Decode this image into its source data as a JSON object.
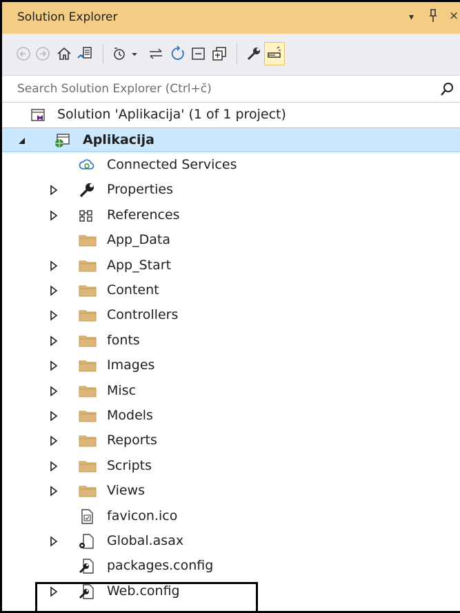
{
  "window": {
    "title": "Solution Explorer",
    "buttons": {
      "dropdown": "▾",
      "pin": "ꟸ",
      "close": "×"
    }
  },
  "toolbar": {
    "items": [
      "back-icon",
      "forward-icon",
      "home-icon",
      "switch-views-icon",
      "pending-changes-filter-icon",
      "sync-icon",
      "refresh-icon",
      "collapse-all-icon",
      "show-all-files-icon",
      "properties-icon",
      "preview-selected-items-icon"
    ]
  },
  "search": {
    "placeholder": "Search Solution Explorer (Ctrl+č)"
  },
  "tree": {
    "solution": {
      "label": "Solution 'Aplikacija' (1 of 1 project)"
    },
    "project": {
      "label": "Aplikacija"
    },
    "items": [
      {
        "label": "Connected Services",
        "icon": "connected-services-icon",
        "expandable": false
      },
      {
        "label": "Properties",
        "icon": "wrench-icon",
        "expandable": true
      },
      {
        "label": "References",
        "icon": "references-icon",
        "expandable": true
      },
      {
        "label": "App_Data",
        "icon": "folder-icon",
        "expandable": false
      },
      {
        "label": "App_Start",
        "icon": "folder-icon",
        "expandable": true
      },
      {
        "label": "Content",
        "icon": "folder-icon",
        "expandable": true
      },
      {
        "label": "Controllers",
        "icon": "folder-icon",
        "expandable": true
      },
      {
        "label": "fonts",
        "icon": "folder-icon",
        "expandable": true
      },
      {
        "label": "Images",
        "icon": "folder-icon",
        "expandable": true
      },
      {
        "label": "Misc",
        "icon": "folder-icon",
        "expandable": true
      },
      {
        "label": "Models",
        "icon": "folder-icon",
        "expandable": true
      },
      {
        "label": "Reports",
        "icon": "folder-icon",
        "expandable": true
      },
      {
        "label": "Scripts",
        "icon": "folder-icon",
        "expandable": true
      },
      {
        "label": "Views",
        "icon": "folder-icon",
        "expandable": true
      },
      {
        "label": "favicon.ico",
        "icon": "image-file-icon",
        "expandable": false
      },
      {
        "label": "Global.asax",
        "icon": "asax-file-icon",
        "expandable": true
      },
      {
        "label": "packages.config",
        "icon": "config-file-icon",
        "expandable": false
      },
      {
        "label": "Web.config",
        "icon": "config-file-icon",
        "expandable": true
      }
    ]
  },
  "colors": {
    "titlebar": "#f5cc84",
    "selection": "#cce8ff",
    "folder": "#dcb67a"
  }
}
